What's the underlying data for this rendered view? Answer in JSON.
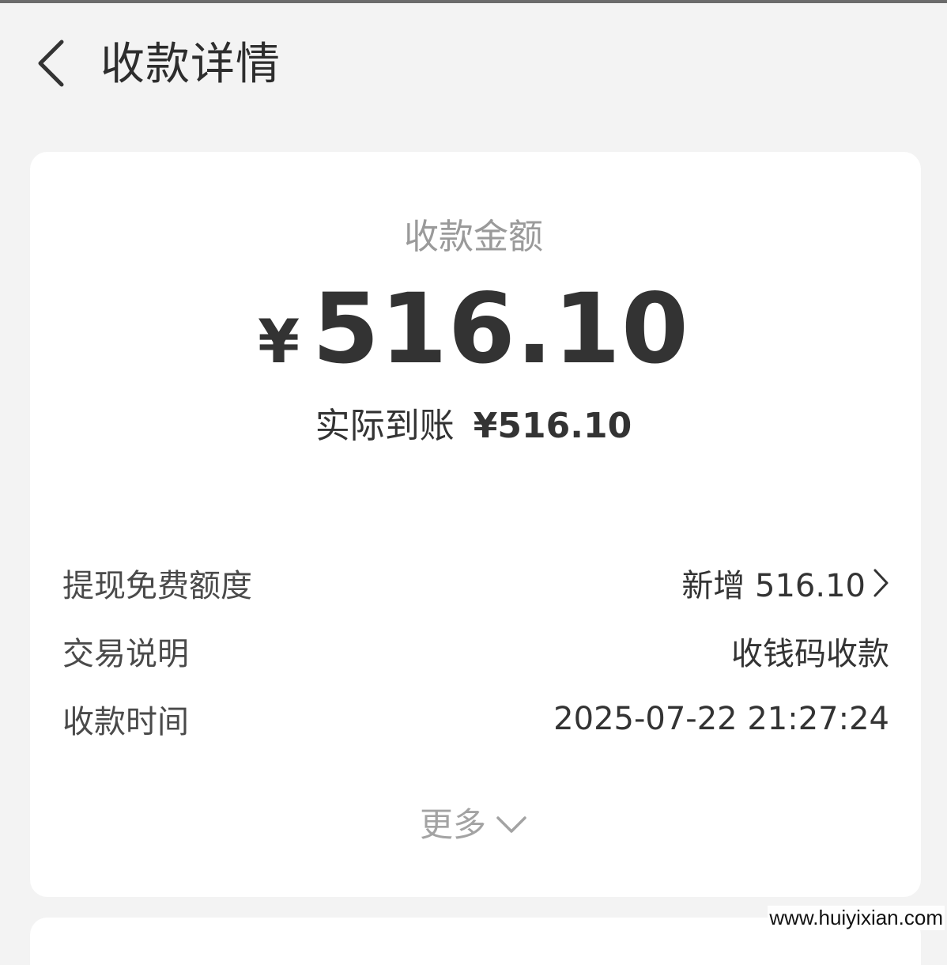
{
  "header": {
    "back_icon": "chevron-left-icon",
    "title": "收款详情"
  },
  "summary": {
    "amount_label": "收款金额",
    "currency_symbol": "¥",
    "amount": "516.10",
    "received_label": "实际到账",
    "received_amount": "¥516.10"
  },
  "details": {
    "rows": [
      {
        "label": "提现免费额度",
        "value": "新增 516.10",
        "icon": "chevron-right-icon"
      },
      {
        "label": "交易说明",
        "value": "收钱码收款"
      },
      {
        "label": "收款时间",
        "value": "2025-07-22 21:27:24"
      }
    ],
    "more_label": "更多",
    "more_icon": "chevron-down-icon"
  },
  "watermark": "www.huiyixian.com",
  "colors": {
    "page_background": "#f3f3f3",
    "card_background": "#ffffff",
    "primary_text": "#333333",
    "secondary_text": "#9a9a9a"
  }
}
